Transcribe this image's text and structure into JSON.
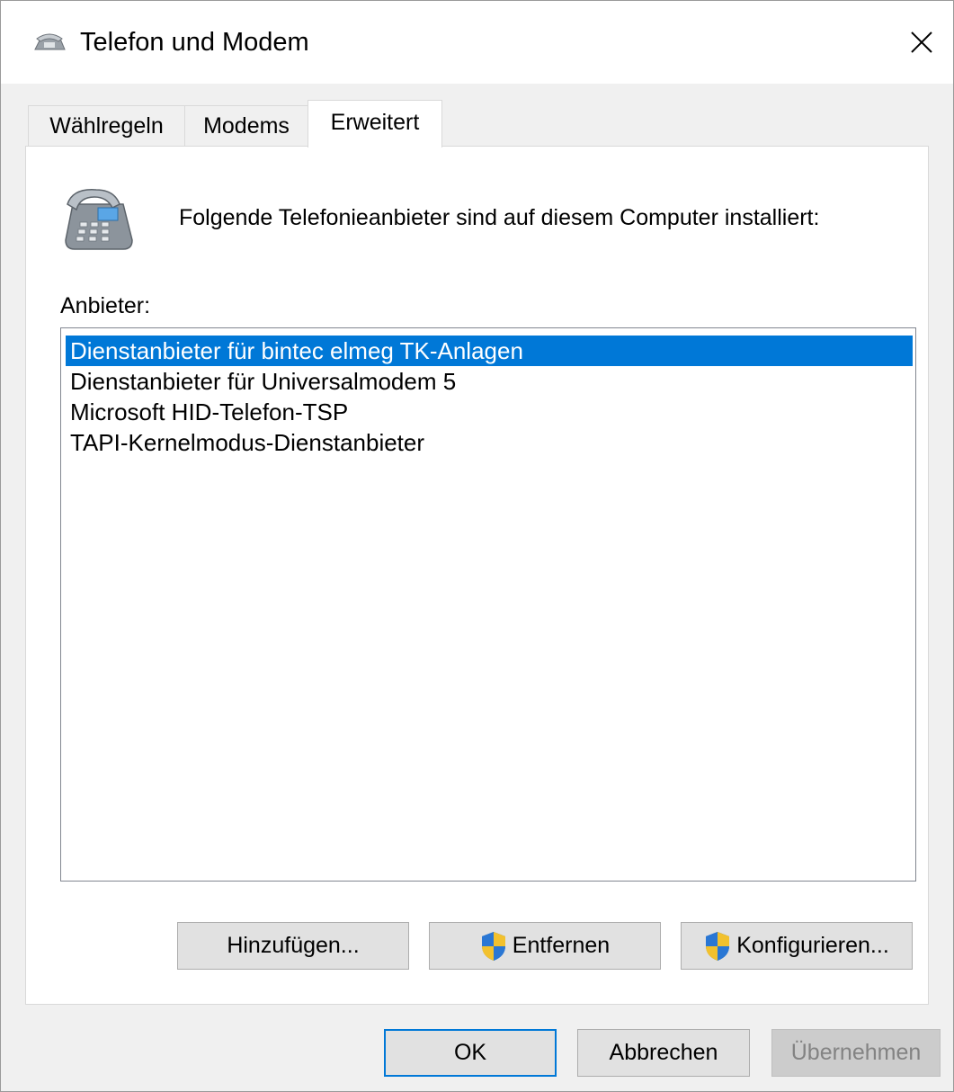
{
  "window": {
    "title": "Telefon und Modem"
  },
  "tabs": [
    {
      "label": "Wählregeln",
      "active": false
    },
    {
      "label": "Modems",
      "active": false
    },
    {
      "label": "Erweitert",
      "active": true
    }
  ],
  "panel": {
    "info_text": "Folgende Telefonieanbieter sind auf diesem Computer installiert:",
    "list_label": "Anbieter:",
    "providers": [
      "Dienstanbieter für bintec elmeg TK-Anlagen",
      "Dienstanbieter für Universalmodem 5",
      "Microsoft HID-Telefon-TSP",
      "TAPI-Kernelmodus-Dienstanbieter"
    ],
    "selected_index": 0,
    "buttons": {
      "add": "Hinzufügen...",
      "remove": "Entfernen",
      "configure": "Konfigurieren..."
    }
  },
  "footer": {
    "ok": "OK",
    "cancel": "Abbrechen",
    "apply": "Übernehmen"
  },
  "colors": {
    "selection": "#0078d7",
    "default_button_border": "#0078d7"
  }
}
